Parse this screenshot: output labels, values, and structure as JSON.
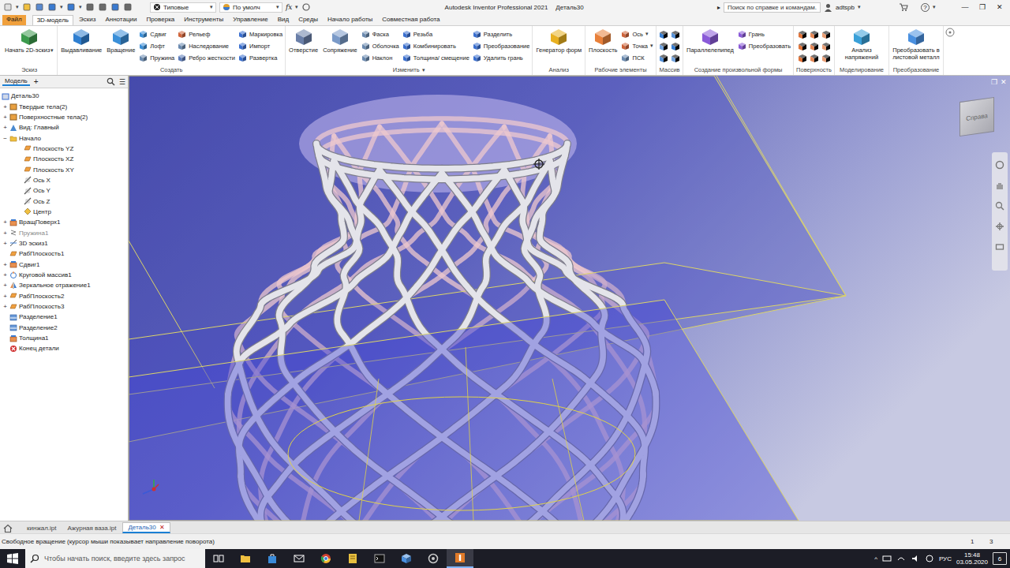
{
  "window": {
    "title": "Autodesk Inventor Professional 2021",
    "document": "Деталь30",
    "controls": [
      "—",
      "❐",
      "✕"
    ]
  },
  "quick_access": {
    "appearance": "Типовые",
    "material": "По умолч",
    "formula": "fx",
    "arrow": "▾"
  },
  "help": {
    "arrow": "▸",
    "search": "Поиск по справке и командам.",
    "user": "adtspb",
    "help": "?"
  },
  "menu_tabs": [
    {
      "label": "Файл",
      "selected": false,
      "kind": "file"
    },
    {
      "label": "3D-модель",
      "selected": true,
      "kind": "tab"
    },
    {
      "label": "Эскиз",
      "selected": false,
      "kind": "tab"
    },
    {
      "label": "Аннотации",
      "selected": false,
      "kind": "tab"
    },
    {
      "label": "Проверка",
      "selected": false,
      "kind": "tab"
    },
    {
      "label": "Инструменты",
      "selected": false,
      "kind": "tab"
    },
    {
      "label": "Управление",
      "selected": false,
      "kind": "tab"
    },
    {
      "label": "Вид",
      "selected": false,
      "kind": "tab"
    },
    {
      "label": "Среды",
      "selected": false,
      "kind": "tab"
    },
    {
      "label": "Начало работы",
      "selected": false,
      "kind": "tab"
    },
    {
      "label": "Совместная работа",
      "selected": false,
      "kind": "tab"
    }
  ],
  "ribbon": {
    "groups": [
      {
        "label": "Эскиз",
        "items": [
          {
            "kind": "large",
            "label": "Начать 2D-эскиз",
            "arrow": "▾",
            "color": "#3c9a4c"
          }
        ]
      },
      {
        "label": "Создать",
        "items": [
          {
            "kind": "large",
            "label": "Выдавливание",
            "color": "#2f7fd0"
          },
          {
            "kind": "large",
            "label": "Вращение",
            "color": "#3a8fd8"
          },
          {
            "kind": "column",
            "buttons": [
              {
                "label": "Сдвиг",
                "color": "#3a8fd8"
              },
              {
                "label": "Лофт",
                "color": "#3a8fd8"
              },
              {
                "label": "Пружина",
                "color": "#6a8ab0"
              }
            ]
          },
          {
            "kind": "column",
            "buttons": [
              {
                "label": "Рельеф",
                "color": "#d0643a"
              },
              {
                "label": "Наследование",
                "color": "#6a8ab0"
              },
              {
                "label": "Ребро жесткости",
                "color": "#5a7ab8"
              }
            ]
          },
          {
            "kind": "column",
            "buttons": [
              {
                "label": "Маркировка",
                "color": "#3a6fd0"
              },
              {
                "label": "Импорт",
                "color": "#3a6fd0"
              },
              {
                "label": "Развертка",
                "color": "#3a6fd0"
              }
            ]
          }
        ]
      },
      {
        "label": "Изменить",
        "arrow": "▾",
        "items": [
          {
            "kind": "large",
            "label": "Отверстие",
            "color": "#6a7fa8"
          },
          {
            "kind": "large",
            "label": "Сопряжение",
            "color": "#7a9ac8"
          },
          {
            "kind": "column",
            "buttons": [
              {
                "label": "Фаска",
                "color": "#6a8ab0"
              },
              {
                "label": "Оболочка",
                "color": "#6a8ab0"
              },
              {
                "label": "Наклон",
                "color": "#6a8ab0"
              }
            ]
          },
          {
            "kind": "column",
            "buttons": [
              {
                "label": "Резьба",
                "color": "#3a6fd0"
              },
              {
                "label": "Комбинировать",
                "color": "#3a6fd0"
              },
              {
                "label": "Толщина/ смещение",
                "color": "#3a6fd0"
              }
            ]
          },
          {
            "kind": "column",
            "buttons": [
              {
                "label": "Разделить",
                "color": "#3a6fd0"
              },
              {
                "label": "Преобразование",
                "color": "#3a6fd0"
              },
              {
                "label": "Удалить грань",
                "color": "#3a6fd0"
              }
            ]
          }
        ]
      },
      {
        "label": "Анализ",
        "items": [
          {
            "kind": "large",
            "label": "Генератор форм",
            "color": "#e8b020"
          }
        ]
      },
      {
        "label": "Рабочие элементы",
        "items": [
          {
            "kind": "large",
            "label": "Плоскость",
            "color": "#e8803a"
          },
          {
            "kind": "column",
            "buttons": [
              {
                "label": "Ось",
                "arrow": "▾",
                "color": "#d0643a"
              },
              {
                "label": "Точка",
                "arrow": "▾",
                "color": "#d0643a"
              },
              {
                "label": "ПСК",
                "color": "#6a8ab0"
              }
            ]
          }
        ]
      },
      {
        "label": "Массив",
        "items": [
          {
            "kind": "icons",
            "count": 6,
            "columns": 2,
            "color": "#3a7fd0"
          }
        ]
      },
      {
        "label": "Создание произвольной формы",
        "items": [
          {
            "kind": "large",
            "label": "Параллелепипед",
            "color": "#8a5ad8"
          },
          {
            "kind": "column",
            "buttons": [
              {
                "label": "Грань",
                "color": "#8a5ad8"
              },
              {
                "label": "Преобразовать",
                "color": "#8a5ad8"
              }
            ]
          }
        ]
      },
      {
        "label": "Поверхность",
        "items": [
          {
            "kind": "icons",
            "count": 9,
            "columns": 3,
            "color": "#e0743a"
          }
        ]
      },
      {
        "label": "Моделирование",
        "items": [
          {
            "kind": "large",
            "label": "Анализ напряжений",
            "color": "#3aa0d8"
          }
        ]
      },
      {
        "label": "Преобразование",
        "items": [
          {
            "kind": "large",
            "label": "Преобразовать в листовой металл",
            "color": "#4a90e0"
          }
        ]
      }
    ]
  },
  "browser": {
    "title": "Модель",
    "add": "+",
    "menu": "☰",
    "items": [
      {
        "label": "Деталь30",
        "level": 0,
        "expander": "",
        "expanded": true,
        "kind": "part",
        "disabled": false
      },
      {
        "label": "Твердые тела(2)",
        "level": 1,
        "expander": "+",
        "expanded": false,
        "kind": "bodies",
        "disabled": false
      },
      {
        "label": "Поверхностные тела(2)",
        "level": 1,
        "expander": "+",
        "expanded": false,
        "kind": "bodies",
        "disabled": false
      },
      {
        "label": "Вид: Главный",
        "level": 1,
        "expander": "+",
        "expanded": false,
        "kind": "view",
        "disabled": false
      },
      {
        "label": "Начало",
        "level": 1,
        "expander": "−",
        "expanded": true,
        "kind": "folder",
        "disabled": false
      },
      {
        "label": "Плоскость YZ",
        "level": 2,
        "expander": "",
        "expanded": false,
        "kind": "plane",
        "disabled": false
      },
      {
        "label": "Плоскость XZ",
        "level": 2,
        "expander": "",
        "expanded": false,
        "kind": "plane",
        "disabled": false
      },
      {
        "label": "Плоскость XY",
        "level": 2,
        "expander": "",
        "expanded": false,
        "kind": "plane",
        "disabled": false
      },
      {
        "label": "Ось X",
        "level": 2,
        "expander": "",
        "expanded": false,
        "kind": "axis",
        "disabled": false
      },
      {
        "label": "Ось Y",
        "level": 2,
        "expander": "",
        "expanded": false,
        "kind": "axis",
        "disabled": false
      },
      {
        "label": "Ось Z",
        "level": 2,
        "expander": "",
        "expanded": false,
        "kind": "axis",
        "disabled": false
      },
      {
        "label": "Центр",
        "level": 2,
        "expander": "",
        "expanded": false,
        "kind": "point",
        "disabled": false
      },
      {
        "label": "ВращПоверх1",
        "level": 1,
        "expander": "+",
        "expanded": false,
        "kind": "feature",
        "disabled": false
      },
      {
        "label": "Пружина1",
        "level": 1,
        "expander": "+",
        "expanded": false,
        "kind": "spring",
        "disabled": true
      },
      {
        "label": "3D эскиз1",
        "level": 1,
        "expander": "+",
        "expanded": false,
        "kind": "sketch",
        "disabled": false
      },
      {
        "label": "РабПлоскость1",
        "level": 1,
        "expander": "",
        "expanded": false,
        "kind": "plane",
        "disabled": false
      },
      {
        "label": "Сдвиг1",
        "level": 1,
        "expander": "+",
        "expanded": false,
        "kind": "feature",
        "disabled": false
      },
      {
        "label": "Круговой массив1",
        "level": 1,
        "expander": "+",
        "expanded": false,
        "kind": "pattern",
        "disabled": false
      },
      {
        "label": "Зеркальное отражение1",
        "level": 1,
        "expander": "+",
        "expanded": false,
        "kind": "mirror",
        "disabled": false
      },
      {
        "label": "РабПлоскость2",
        "level": 1,
        "expander": "+",
        "expanded": false,
        "kind": "plane",
        "disabled": false
      },
      {
        "label": "РабПлоскость3",
        "level": 1,
        "expander": "+",
        "expanded": false,
        "kind": "plane",
        "disabled": false
      },
      {
        "label": "Разделение1",
        "level": 1,
        "expander": "",
        "expanded": false,
        "kind": "split",
        "disabled": false
      },
      {
        "label": "Разделение2",
        "level": 1,
        "expander": "",
        "expanded": false,
        "kind": "split",
        "disabled": false
      },
      {
        "label": "Толщина1",
        "level": 1,
        "expander": "",
        "expanded": false,
        "kind": "feature",
        "disabled": false
      },
      {
        "label": "Конец детали",
        "level": 1,
        "expander": "",
        "expanded": false,
        "kind": "end",
        "disabled": false
      }
    ]
  },
  "viewport": {
    "viewcube": "Справа",
    "controls": [
      "❐",
      "✕"
    ]
  },
  "doc_tabs": {
    "items": [
      {
        "label": "кинжал.ipt",
        "selected": false,
        "close": ""
      },
      {
        "label": "Ажурная ваза.ipt",
        "selected": false,
        "close": ""
      },
      {
        "label": "Деталь30",
        "selected": true,
        "close": "✕"
      }
    ]
  },
  "status_bar": {
    "message": "Свободное вращение (курсор мыши показывает направление поворота)",
    "counts": [
      "1",
      "3"
    ]
  },
  "taskbar": {
    "search": "Чтобы начать поиск, введите здесь запрос",
    "tray_arrow": "^",
    "language": "РУС",
    "time": "15:48",
    "date": "03.05.2020",
    "notifications": "6"
  }
}
